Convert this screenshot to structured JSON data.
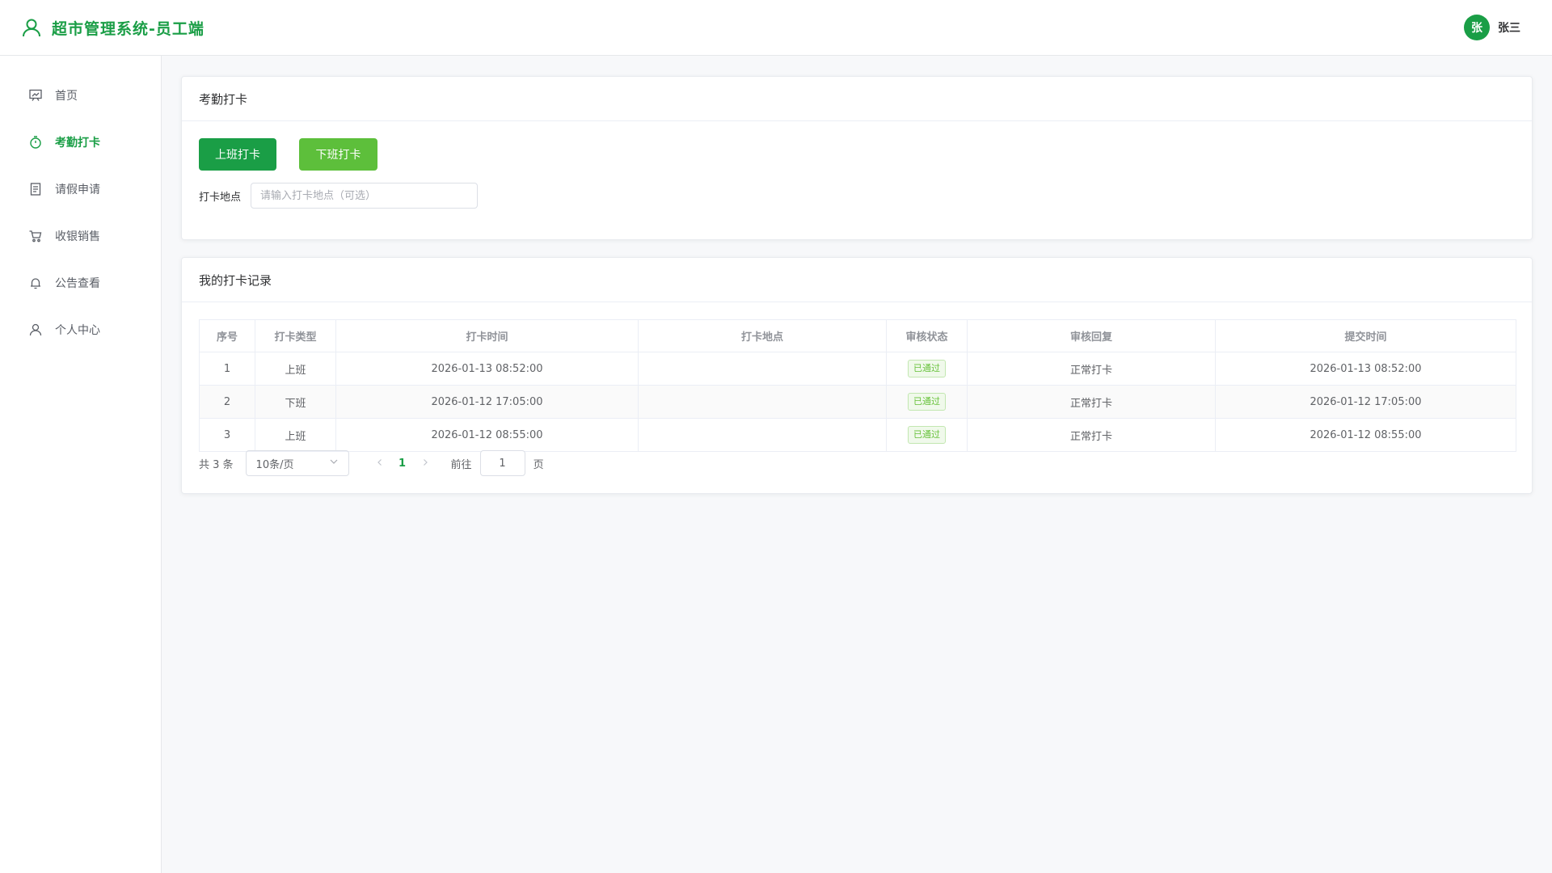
{
  "header": {
    "title": "超市管理系统-员工端",
    "avatar_text": "张",
    "user_name": "张三",
    "brand_icon": "user-outline-icon"
  },
  "colors": {
    "primary": "#1a9e46",
    "secondary_button": "#5dbf3b",
    "tag_success": "#67c23a"
  },
  "sidebar": {
    "items": [
      {
        "label": "首页",
        "icon": "presentation-board-icon",
        "active": false
      },
      {
        "label": "考勤打卡",
        "icon": "stopwatch-icon",
        "active": true
      },
      {
        "label": "请假申请",
        "icon": "document-icon",
        "active": false
      },
      {
        "label": "收银销售",
        "icon": "shopping-cart-icon",
        "active": false
      },
      {
        "label": "公告查看",
        "icon": "bell-icon",
        "active": false
      },
      {
        "label": "个人中心",
        "icon": "user-icon",
        "active": false
      }
    ]
  },
  "clock_card": {
    "title": "考勤打卡",
    "clock_in_label": "上班打卡",
    "clock_out_label": "下班打卡",
    "location_label": "打卡地点",
    "location_placeholder": "请输入打卡地点（可选）",
    "location_value": ""
  },
  "records_card": {
    "title": "我的打卡记录",
    "columns": [
      "序号",
      "打卡类型",
      "打卡时间",
      "打卡地点",
      "审核状态",
      "审核回复",
      "提交时间"
    ],
    "rows": [
      {
        "index": "1",
        "type": "上班",
        "time": "2026-01-13 08:52:00",
        "location": "",
        "status": "已通过",
        "reply": "正常打卡",
        "submitted": "2026-01-13 08:52:00"
      },
      {
        "index": "2",
        "type": "下班",
        "time": "2026-01-12 17:05:00",
        "location": "",
        "status": "已通过",
        "reply": "正常打卡",
        "submitted": "2026-01-12 17:05:00"
      },
      {
        "index": "3",
        "type": "上班",
        "time": "2026-01-12 08:55:00",
        "location": "",
        "status": "已通过",
        "reply": "正常打卡",
        "submitted": "2026-01-12 08:55:00"
      }
    ],
    "pagination": {
      "total_text": "共 3 条",
      "page_size": "10条/页",
      "current_page": "1",
      "goto_label": "前往",
      "goto_value": "1",
      "page_suffix": "页"
    }
  }
}
